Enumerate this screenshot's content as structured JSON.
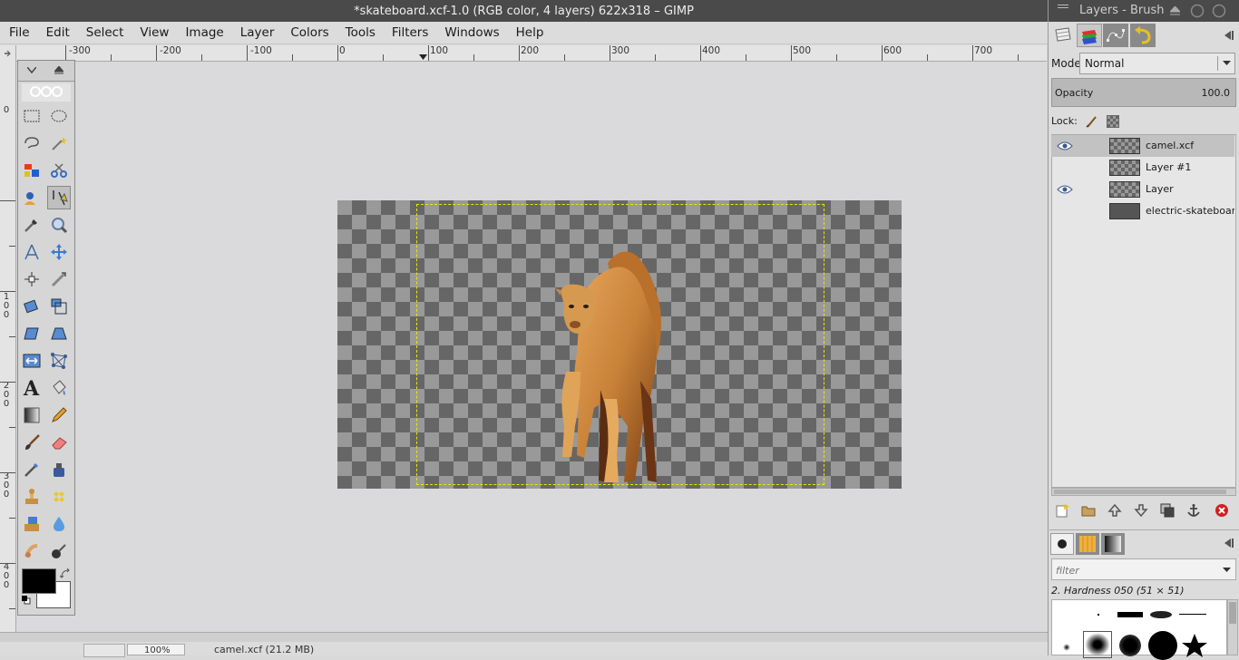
{
  "window": {
    "title": "*skateboard.xcf-1.0 (RGB color, 4 layers) 622x318 – GIMP"
  },
  "menu": [
    "File",
    "Edit",
    "Select",
    "View",
    "Image",
    "Layer",
    "Colors",
    "Tools",
    "Filters",
    "Windows",
    "Help"
  ],
  "rulers": {
    "top_labels": [
      "-300",
      "-200",
      "-100",
      "0",
      "100",
      "200",
      "300",
      "400",
      "500",
      "600",
      "700"
    ],
    "left_labels": [
      "0",
      "1 0 0",
      "2 0 0",
      "3 0 0",
      "4 0 0"
    ]
  },
  "statusbar": {
    "zoom": "100%",
    "info": "camel.xcf (21.2 MB)"
  },
  "dock": {
    "title": "Layers - Brush",
    "mode_label": "Mode:",
    "mode_value": "Normal",
    "opacity_label": "Opacity",
    "opacity_value": "100.0",
    "lock_label": "Lock:",
    "layers": [
      {
        "name": "camel.xcf",
        "visible": true,
        "selected": true
      },
      {
        "name": "Layer #1",
        "visible": false,
        "selected": false
      },
      {
        "name": "Layer",
        "visible": true,
        "selected": false
      },
      {
        "name": "electric-skateboard.jpg",
        "visible": false,
        "selected": false
      }
    ],
    "brush_filter_placeholder": "filter",
    "brush_name": "2. Hardness 050 (51 × 51)"
  },
  "colors": {
    "fg": "#000000",
    "bg": "#ffffff",
    "boundary": "#e8e800"
  }
}
